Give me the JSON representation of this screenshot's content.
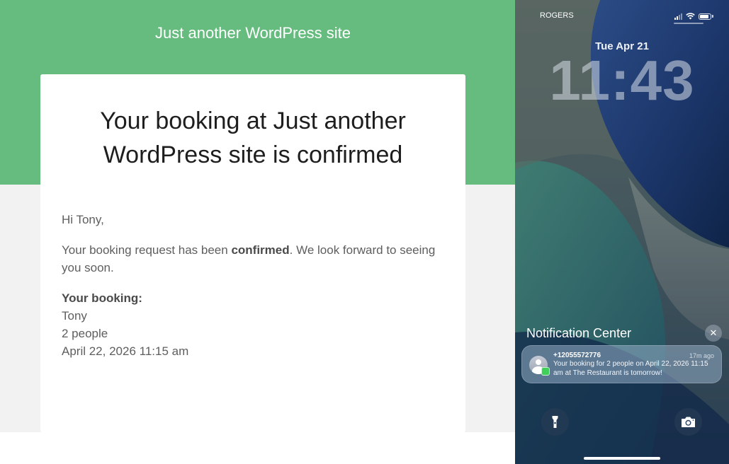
{
  "email": {
    "site_title": "Just another WordPress site",
    "heading": "Your booking at Just another WordPress site is confirmed",
    "greeting": "Hi Tony,",
    "message_before": "Your booking request has been ",
    "message_bold": "confirmed",
    "message_after": ". We look forward to seeing you soon.",
    "booking_label": "Your booking:",
    "booking_name": "Tony",
    "booking_party": "2 people",
    "booking_datetime": "April 22, 2026 11:15 am",
    "colors": {
      "header_green": "#66bc7e",
      "footer_grey": "#f2f2f2"
    }
  },
  "phone": {
    "carrier": "ROGERS",
    "date": "Tue Apr 21",
    "time": "11:43",
    "notification_center_title": "Notification Center",
    "notification": {
      "sender": "+12055572776",
      "time_ago": "17m ago",
      "text": "Your booking for 2 people on April 22, 2026 11:15 am at The Restaurant is tomorrow!"
    },
    "icons": [
      "signal-icon",
      "wifi-icon",
      "battery-icon",
      "close-icon",
      "contact-avatar-icon",
      "messages-icon",
      "flashlight-icon",
      "camera-icon"
    ]
  }
}
